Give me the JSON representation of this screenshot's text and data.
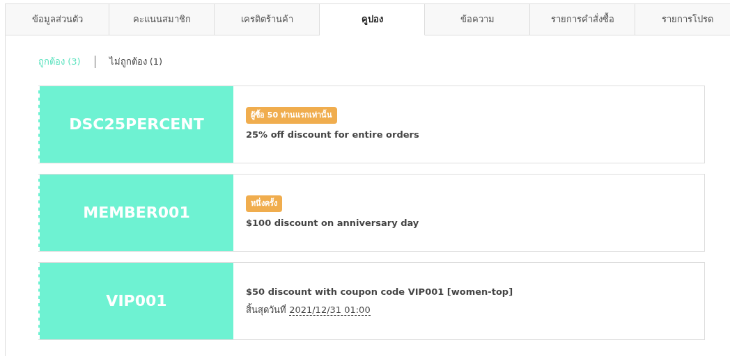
{
  "tabs": [
    {
      "label": "ข้อมูลส่วนตัว",
      "selected": false
    },
    {
      "label": "คะแนนสมาชิก",
      "selected": false
    },
    {
      "label": "เครดิตร้านค้า",
      "selected": false
    },
    {
      "label": "คูปอง",
      "selected": true
    },
    {
      "label": "ข้อความ",
      "selected": false
    },
    {
      "label": "รายการคำสั่งซื้อ",
      "selected": false
    },
    {
      "label": "รายการโปรด",
      "selected": false
    }
  ],
  "filters": [
    {
      "label": "ถูกต้อง (3)",
      "selected": true
    },
    {
      "label": "ไม่ถูกต้อง (1)",
      "selected": false
    }
  ],
  "coupons": [
    {
      "code": "DSC25PERCENT",
      "badge": "ผู้ซื้อ 50 ท่านแรกเท่านั้น",
      "description": "25% off discount for entire orders"
    },
    {
      "code": "MEMBER001",
      "badge": "หนึ่งครั้ง",
      "description": "$100 discount on anniversary day"
    },
    {
      "code": "VIP001",
      "description": "$50 discount with coupon code VIP001 [women-top]",
      "expiry_label": "สิ้นสุดวันที่",
      "expiry_date": "2021/12/31 01:00"
    }
  ]
}
